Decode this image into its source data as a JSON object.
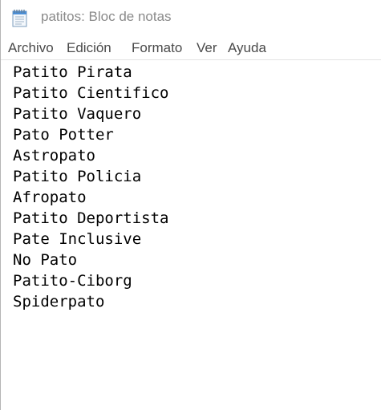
{
  "window": {
    "title": "patitos: Bloc de notas",
    "icon": "notepad-icon"
  },
  "menu": {
    "items": [
      {
        "label": "Archivo"
      },
      {
        "label": "Edición"
      },
      {
        "label": "Formato"
      },
      {
        "label": "Ver"
      },
      {
        "label": "Ayuda"
      }
    ]
  },
  "editor": {
    "lines": [
      "Patito Pirata",
      "Patito Cientifico",
      "Patito Vaquero",
      "Pato Potter",
      "Astropato",
      "Patito Policia",
      "Afropato",
      "Patito Deportista",
      "Pate Inclusive",
      "No Pato",
      "Patito-Ciborg",
      "Spiderpato"
    ]
  },
  "colors": {
    "title_text": "#8a8a8a",
    "menu_text": "#4a4a4a",
    "editor_text": "#000000",
    "background": "#ffffff"
  }
}
